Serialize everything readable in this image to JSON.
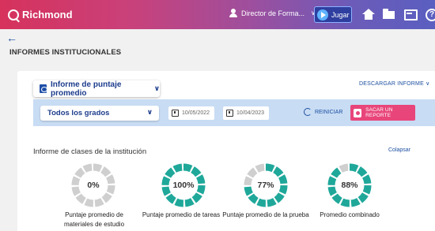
{
  "app": {
    "brand": "Richmond"
  },
  "topbar": {
    "user_name": "Director de Forma...",
    "jugar_label": "Jugar",
    "icons": [
      "person-icon",
      "play-icon",
      "home-icon",
      "folder-icon",
      "chat-icon",
      "help-icon"
    ]
  },
  "page": {
    "back_glyph": "←",
    "title": "INFORMES INSTITUCIONALES"
  },
  "report": {
    "selected": "Informe de puntaje promedio",
    "download_label": "DESCARGAR INFORME"
  },
  "filters": {
    "grades_selected": "Todos los grados",
    "date_from": "10/05/2022",
    "date_to": "10/04/2023",
    "reset_label": "REINICIAR",
    "submit_label": "SACAR UN REPORTE"
  },
  "section": {
    "title": "Informe de clases de la institución",
    "collapse_label": "Colapsar"
  },
  "gauges": [
    {
      "value": 0,
      "display": "0%",
      "label": "Puntaje promedio de materiales de estudio"
    },
    {
      "value": 100,
      "display": "100%",
      "label": "Puntaje promedio de tareas"
    },
    {
      "value": 77,
      "display": "77%",
      "label": "Puntaje promedio de la prueba"
    },
    {
      "value": 88,
      "display": "88%",
      "label": "Promedio combinado"
    }
  ],
  "colors": {
    "gauge_fill": "#1fa89a",
    "gauge_empty": "#cfcfcf",
    "accent_blue": "#1c4fa0",
    "report_button": "#e8457a"
  }
}
